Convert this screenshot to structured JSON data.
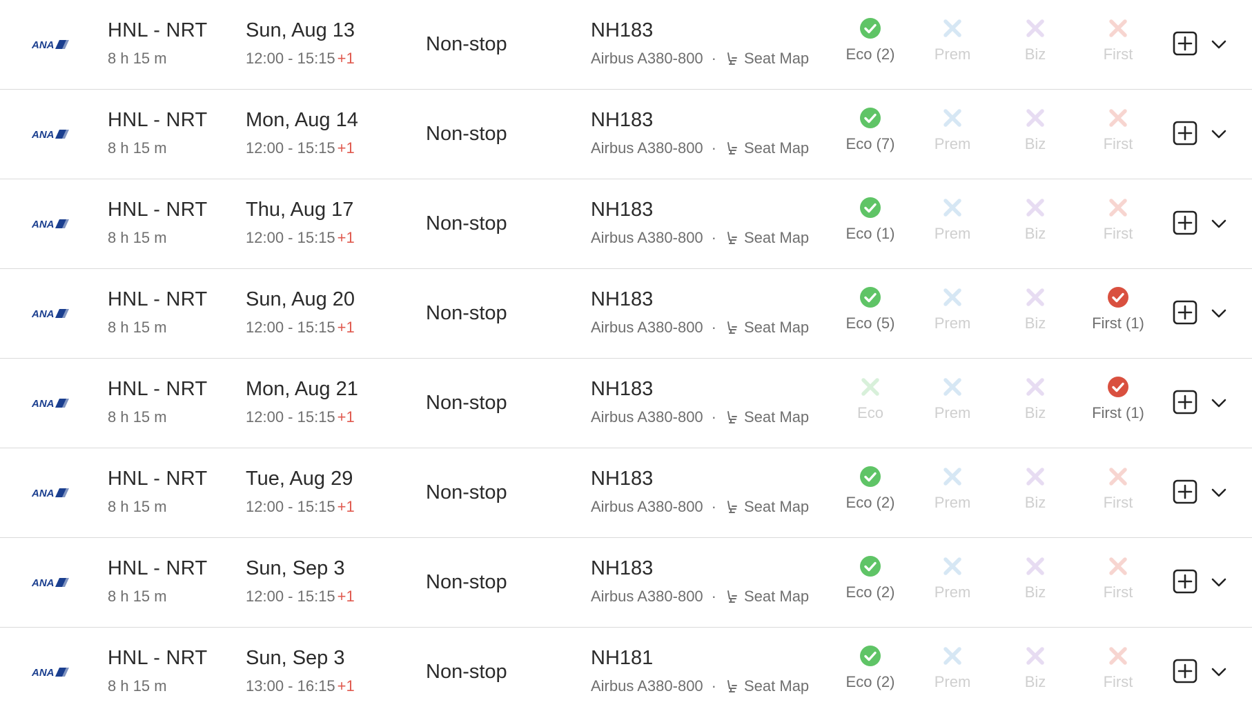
{
  "flights": [
    {
      "airline": "ANA",
      "route": "HNL - NRT",
      "duration": "8 h 15 m",
      "date": "Sun, Aug 13",
      "times": "12:00 - 15:15",
      "plus_day": "+1",
      "stops": "Non-stop",
      "flight_no": "NH183",
      "aircraft": "Airbus A380-800",
      "seat_map": "Seat Map",
      "cabins": {
        "eco": {
          "label": "Eco (2)",
          "available": true
        },
        "prem": {
          "label": "Prem",
          "available": false
        },
        "biz": {
          "label": "Biz",
          "available": false
        },
        "first": {
          "label": "First",
          "available": false
        }
      }
    },
    {
      "airline": "ANA",
      "route": "HNL - NRT",
      "duration": "8 h 15 m",
      "date": "Mon, Aug 14",
      "times": "12:00 - 15:15",
      "plus_day": "+1",
      "stops": "Non-stop",
      "flight_no": "NH183",
      "aircraft": "Airbus A380-800",
      "seat_map": "Seat Map",
      "cabins": {
        "eco": {
          "label": "Eco (7)",
          "available": true
        },
        "prem": {
          "label": "Prem",
          "available": false
        },
        "biz": {
          "label": "Biz",
          "available": false
        },
        "first": {
          "label": "First",
          "available": false
        }
      }
    },
    {
      "airline": "ANA",
      "route": "HNL - NRT",
      "duration": "8 h 15 m",
      "date": "Thu, Aug 17",
      "times": "12:00 - 15:15",
      "plus_day": "+1",
      "stops": "Non-stop",
      "flight_no": "NH183",
      "aircraft": "Airbus A380-800",
      "seat_map": "Seat Map",
      "cabins": {
        "eco": {
          "label": "Eco (1)",
          "available": true
        },
        "prem": {
          "label": "Prem",
          "available": false
        },
        "biz": {
          "label": "Biz",
          "available": false
        },
        "first": {
          "label": "First",
          "available": false
        }
      }
    },
    {
      "airline": "ANA",
      "route": "HNL - NRT",
      "duration": "8 h 15 m",
      "date": "Sun, Aug 20",
      "times": "12:00 - 15:15",
      "plus_day": "+1",
      "stops": "Non-stop",
      "flight_no": "NH183",
      "aircraft": "Airbus A380-800",
      "seat_map": "Seat Map",
      "cabins": {
        "eco": {
          "label": "Eco (5)",
          "available": true
        },
        "prem": {
          "label": "Prem",
          "available": false
        },
        "biz": {
          "label": "Biz",
          "available": false
        },
        "first": {
          "label": "First (1)",
          "available": true
        }
      }
    },
    {
      "airline": "ANA",
      "route": "HNL - NRT",
      "duration": "8 h 15 m",
      "date": "Mon, Aug 21",
      "times": "12:00 - 15:15",
      "plus_day": "+1",
      "stops": "Non-stop",
      "flight_no": "NH183",
      "aircraft": "Airbus A380-800",
      "seat_map": "Seat Map",
      "cabins": {
        "eco": {
          "label": "Eco",
          "available": false
        },
        "prem": {
          "label": "Prem",
          "available": false
        },
        "biz": {
          "label": "Biz",
          "available": false
        },
        "first": {
          "label": "First (1)",
          "available": true
        }
      }
    },
    {
      "airline": "ANA",
      "route": "HNL - NRT",
      "duration": "8 h 15 m",
      "date": "Tue, Aug 29",
      "times": "12:00 - 15:15",
      "plus_day": "+1",
      "stops": "Non-stop",
      "flight_no": "NH183",
      "aircraft": "Airbus A380-800",
      "seat_map": "Seat Map",
      "cabins": {
        "eco": {
          "label": "Eco (2)",
          "available": true
        },
        "prem": {
          "label": "Prem",
          "available": false
        },
        "biz": {
          "label": "Biz",
          "available": false
        },
        "first": {
          "label": "First",
          "available": false
        }
      }
    },
    {
      "airline": "ANA",
      "route": "HNL - NRT",
      "duration": "8 h 15 m",
      "date": "Sun, Sep 3",
      "times": "12:00 - 15:15",
      "plus_day": "+1",
      "stops": "Non-stop",
      "flight_no": "NH183",
      "aircraft": "Airbus A380-800",
      "seat_map": "Seat Map",
      "cabins": {
        "eco": {
          "label": "Eco (2)",
          "available": true
        },
        "prem": {
          "label": "Prem",
          "available": false
        },
        "biz": {
          "label": "Biz",
          "available": false
        },
        "first": {
          "label": "First",
          "available": false
        }
      }
    },
    {
      "airline": "ANA",
      "route": "HNL - NRT",
      "duration": "8 h 15 m",
      "date": "Sun, Sep 3",
      "times": "13:00 - 16:15",
      "plus_day": "+1",
      "stops": "Non-stop",
      "flight_no": "NH181",
      "aircraft": "Airbus A380-800",
      "seat_map": "Seat Map",
      "cabins": {
        "eco": {
          "label": "Eco (2)",
          "available": true
        },
        "prem": {
          "label": "Prem",
          "available": false
        },
        "biz": {
          "label": "Biz",
          "available": false
        },
        "first": {
          "label": "First",
          "available": false
        }
      }
    }
  ],
  "colors": {
    "eco_on": "#5fc466",
    "eco_off": "#d8f0da",
    "prem_off": "#d6e7f4",
    "biz_off": "#e7dcf2",
    "first_on": "#d9503f",
    "first_off": "#f7d5d0",
    "plus_day": "#e05a4f",
    "logo_blue": "#1b3f8f"
  },
  "icons": {
    "airline_logo": "ana-logo",
    "seat": "seat-icon",
    "add": "plus-square-icon",
    "expand": "chevron-down-icon",
    "available": "check-circle-icon",
    "unavailable": "x-icon"
  }
}
